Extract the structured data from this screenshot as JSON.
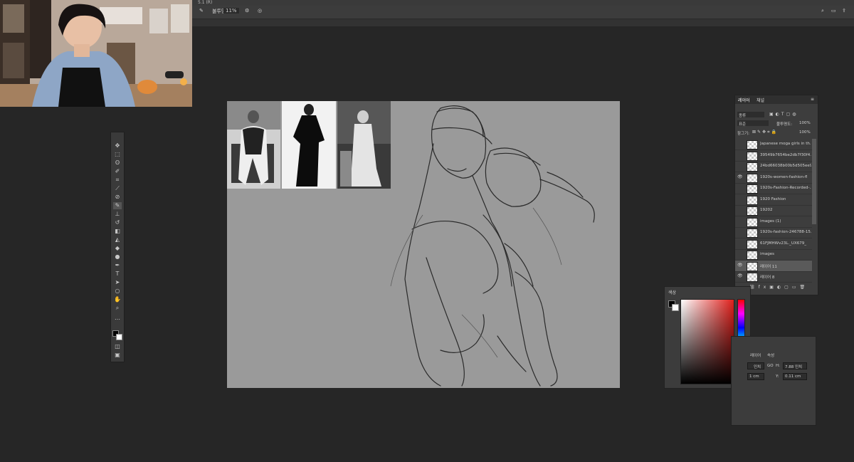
{
  "title_bar": {
    "text": "5.1 (R)"
  },
  "options_bar": {
    "opacity_label": "불투명",
    "opacity_value": "11%"
  },
  "tools": [
    "move-tool",
    "marquee-tool",
    "lasso-tool",
    "quick-select-tool",
    "crop-tool",
    "eyedropper-tool",
    "healing-tool",
    "brush-tool",
    "clone-stamp-tool",
    "history-brush-tool",
    "eraser-tool",
    "paint-bucket-tool",
    "blur-tool",
    "dodge-tool",
    "pen-tool",
    "type-tool",
    "path-select-tool",
    "shape-tool",
    "hand-tool",
    "zoom-tool",
    "more-tools",
    "color-swatches",
    "quick-mask",
    "screen-mode"
  ],
  "layers_panel": {
    "tabs": [
      "레이어",
      "채널"
    ],
    "filter_label": "종류",
    "blend_mode": "표준",
    "opacity_label": "불투명도:",
    "opacity_value": "100%",
    "lock_label": "잠그기:",
    "fill_value": "100%",
    "layers": [
      {
        "name": "Japanese moga girls in th...",
        "visible": false,
        "selected": false
      },
      {
        "name": "39549b7654be2db7f30f4...",
        "visible": false,
        "selected": false
      },
      {
        "name": "24bd66038b00b5d505ee95...",
        "visible": false,
        "selected": false
      },
      {
        "name": "1920s-women-fashion-fl",
        "visible": true,
        "selected": false
      },
      {
        "name": "1920s-Fashion-Recorded-...",
        "visible": false,
        "selected": false
      },
      {
        "name": "1920 Fashion",
        "visible": false,
        "selected": false
      },
      {
        "name": "19202",
        "visible": false,
        "selected": false
      },
      {
        "name": "images (1)",
        "visible": false,
        "selected": false
      },
      {
        "name": "1920s-fashion-246788-15...",
        "visible": false,
        "selected": false
      },
      {
        "name": "61FJMHWv23L._UX679_",
        "visible": false,
        "selected": false
      },
      {
        "name": "images",
        "visible": false,
        "selected": false
      },
      {
        "name": "레이어 11",
        "visible": true,
        "selected": true
      },
      {
        "name": "레이어 8",
        "visible": true,
        "selected": false
      }
    ]
  },
  "color_panel": {
    "tab": "색상",
    "hue_selected": "#e0201c"
  },
  "properties_panel": {
    "tabs": [
      "레이어",
      "속성"
    ],
    "w_value": "인치",
    "w_unit_label": "GO",
    "h_value": "7.88 인치",
    "x_value": "1 cm",
    "y_label": "Y:",
    "y_value": "0.11 cm"
  },
  "colors": {
    "canvas_bg": "#9a9a9a",
    "workspace": "#262626",
    "panel": "#3c3c3c"
  }
}
